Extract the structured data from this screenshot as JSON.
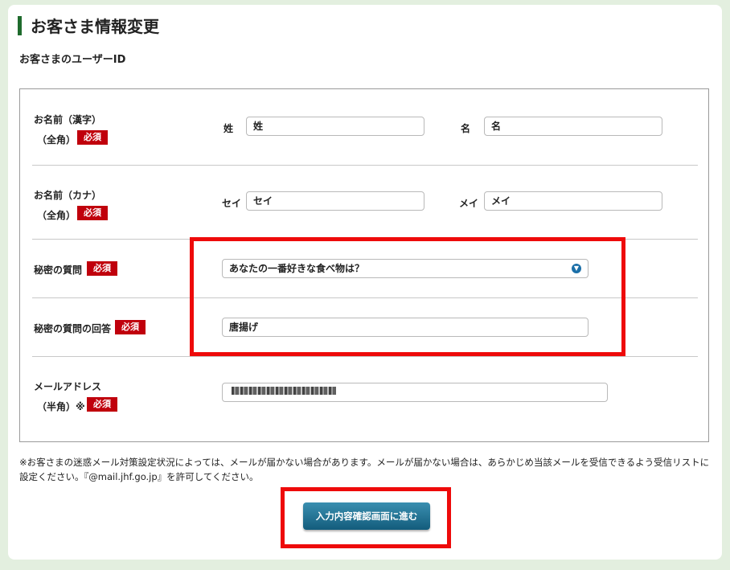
{
  "page": {
    "title": "お客さま情報変更",
    "user_id_label": "お客さまのユーザーID"
  },
  "form": {
    "required_badge": "必須",
    "name_kanji": {
      "label_line1": "お名前（漢字）",
      "label_line2": "（全角）",
      "last_label": "姓",
      "last_value": "姓",
      "first_label": "名",
      "first_value": "名"
    },
    "name_kana": {
      "label_line1": "お名前（カナ）",
      "label_line2": "（全角）",
      "last_label": "セイ",
      "last_value": "セイ",
      "first_label": "メイ",
      "first_value": "メイ"
    },
    "secret_question": {
      "label": "秘密の質問",
      "selected": "あなたの一番好きな食べ物は？"
    },
    "secret_answer": {
      "label": "秘密の質問の回答",
      "value": "唐揚げ"
    },
    "email": {
      "label_line1": "メールアドレス",
      "label_line2": "（半角）※"
    }
  },
  "notice": "※お客さまの迷惑メール対策設定状況によっては、メールが届かない場合があります。メールが届かない場合は、あらかじめ当該メールを受信できるよう受信リストに設定ください。『@mail.jhf.go.jp』を許可してください。",
  "submit_label": "入力内容確認画面に進む",
  "colors": {
    "accent_green": "#1f6b2d",
    "required_red": "#c0000c",
    "highlight_red": "#ee0a0a",
    "button_blue": "#1b6a8c"
  }
}
